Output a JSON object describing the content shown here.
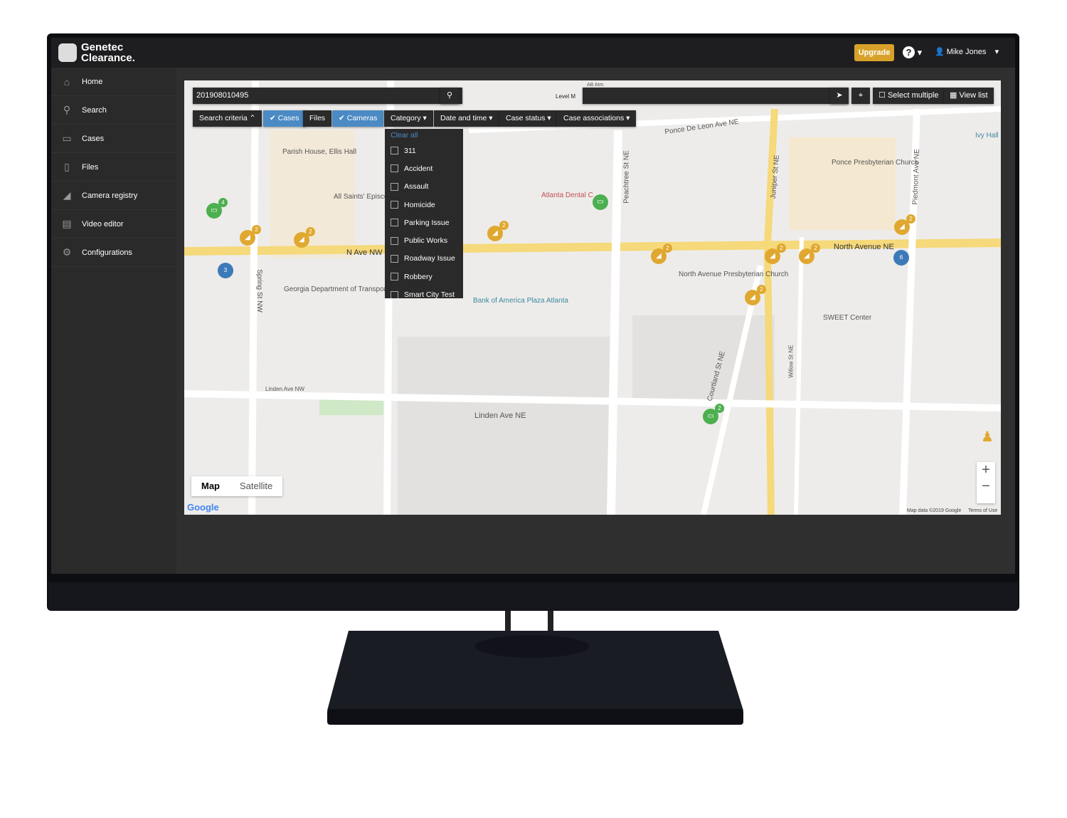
{
  "app": {
    "brand_line1": "Genetec",
    "brand_line2": "Clearance.",
    "upgrade": "Upgrade",
    "help": "?",
    "user": "Mike Jones"
  },
  "sidebar": {
    "items": [
      {
        "label": "Home",
        "icon": "home-icon"
      },
      {
        "label": "Search",
        "icon": "search-icon"
      },
      {
        "label": "Cases",
        "icon": "folder-icon"
      },
      {
        "label": "Files",
        "icon": "file-icon"
      },
      {
        "label": "Camera registry",
        "icon": "camera-icon"
      },
      {
        "label": "Video editor",
        "icon": "film-icon"
      },
      {
        "label": "Configurations",
        "icon": "gear-icon"
      }
    ]
  },
  "search": {
    "value": "201908010495",
    "location_value": "",
    "select_multiple": "Select multiple",
    "view_list": "View list"
  },
  "filters": {
    "search_criteria": "Search criteria",
    "cases": "Cases",
    "files": "Files",
    "cameras": "Cameras",
    "category": "Category",
    "date_time": "Date and time",
    "case_status": "Case status",
    "case_associations": "Case associations"
  },
  "category_menu": {
    "clear_all": "Clear all",
    "items": [
      "311",
      "Accident",
      "Assault",
      "Homicide",
      "Parking Issue",
      "Public Works",
      "Roadway Issue",
      "Robbery",
      "Smart City Test"
    ]
  },
  "map": {
    "labels": [
      "Parish House, Ellis Hall",
      "All Saints' Episcopal Church",
      "Georgia Department of Transportation",
      "N Ave NW",
      "Spring St NW",
      "Linden Ave NW",
      "Atlanta Dental C",
      "Ponce De Leon Ave NE",
      "Peachtree St NE",
      "North Avenue NE",
      "North Avenue Presbyterian Church",
      "Bank of America Plaza Atlanta",
      "Linden Ave NE",
      "Juniper St NE",
      "Ponce Presbyterian Church",
      "Piedmont Ave NE",
      "Ivy Hall",
      "SWEET Center",
      "Courtland St NE",
      "Willow St NE",
      "Level M",
      "AB Atm"
    ],
    "type_map": "Map",
    "type_satellite": "Satellite",
    "attribution": "Map data ©2019 Google",
    "terms": "Terms of Use",
    "google": "Google",
    "zoom_in": "+",
    "zoom_out": "−"
  },
  "markers": {
    "cluster_a": "3",
    "cluster_b": "6",
    "case_a": "4",
    "case_b": "2",
    "cam": "2"
  },
  "colors": {
    "accent": "#4b8ac4",
    "upgrade": "#d8a22a",
    "camera_marker": "#e0a830",
    "case_marker": "#4caf50"
  }
}
